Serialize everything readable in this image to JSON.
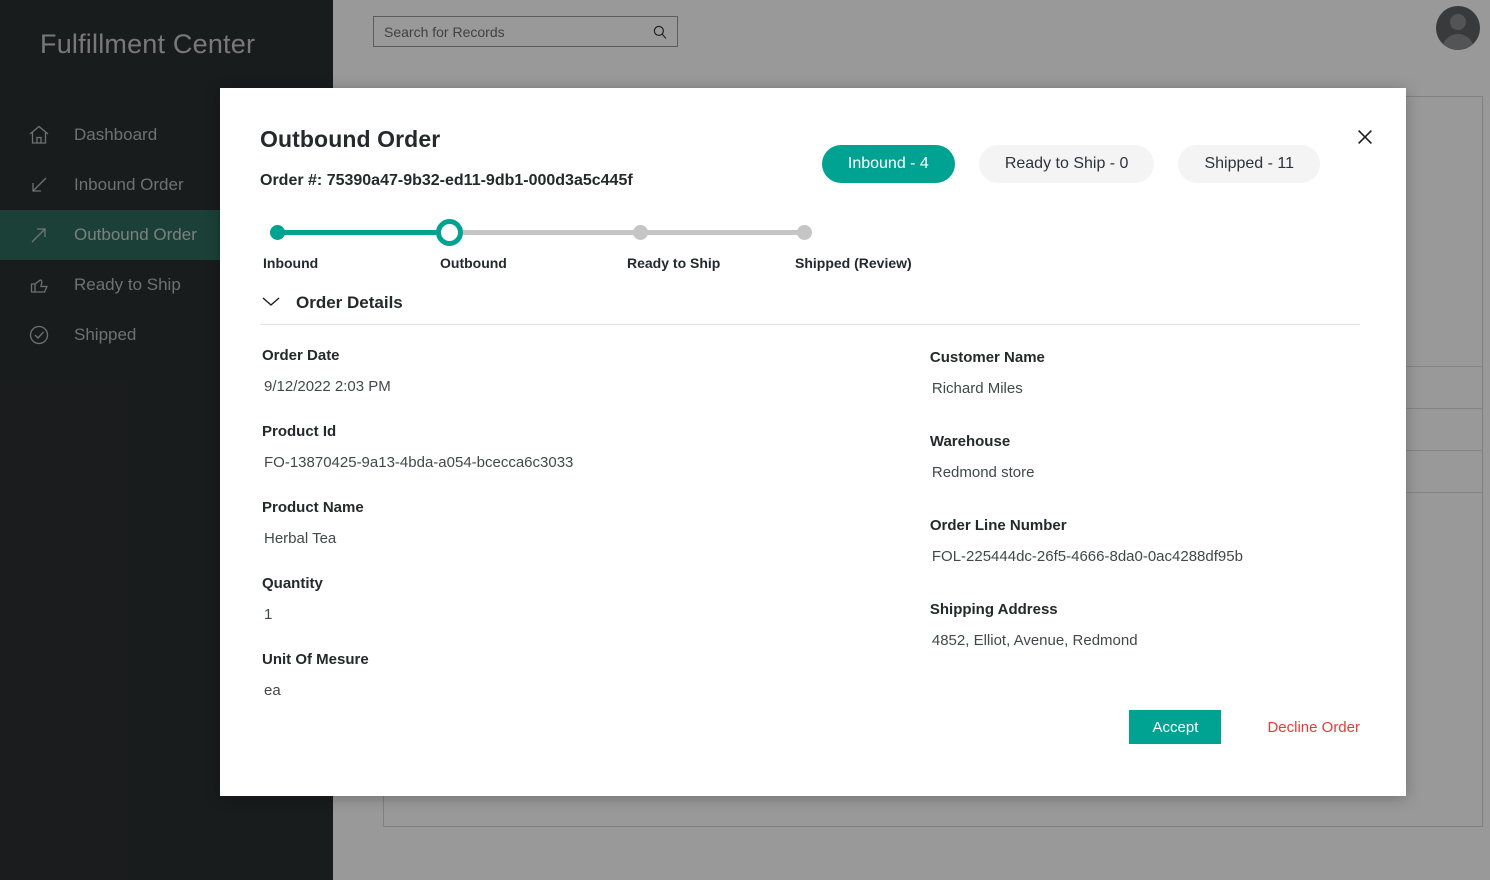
{
  "sidebar": {
    "brand": "Fulfillment Center",
    "items": [
      {
        "label": "Dashboard",
        "icon": "home-icon",
        "active": false
      },
      {
        "label": "Inbound Order",
        "icon": "arrow-down-left-icon",
        "active": false
      },
      {
        "label": "Outbound Order",
        "icon": "arrow-up-right-icon",
        "active": true
      },
      {
        "label": "Ready to Ship",
        "icon": "thumbs-up-icon",
        "active": false
      },
      {
        "label": "Shipped",
        "icon": "check-circle-icon",
        "active": false
      }
    ]
  },
  "topbar": {
    "search_placeholder": "Search for Records",
    "search_value": "",
    "search_icon": "search-icon",
    "avatar_icon": "user-avatar-icon"
  },
  "modal": {
    "title": "Outbound Order",
    "order_number_label": "Order #: 75390a47-9b32-ed11-9db1-000d3a5c445f",
    "close_icon": "close-icon",
    "tabs": [
      {
        "label": "Inbound - 4",
        "active": true
      },
      {
        "label": "Ready to Ship - 0",
        "active": false
      },
      {
        "label": "Shipped - 11",
        "active": false
      }
    ],
    "stepper": {
      "steps": [
        {
          "label": "Inbound",
          "state": "done"
        },
        {
          "label": "Outbound",
          "state": "current"
        },
        {
          "label": "Ready to Ship",
          "state": "pending"
        },
        {
          "label": "Shipped (Review)",
          "state": "pending"
        }
      ]
    },
    "section": {
      "title": "Order Details",
      "chevron_icon": "chevron-down-icon"
    },
    "fields_left": [
      {
        "label": "Order Date",
        "value": "9/12/2022 2:03 PM"
      },
      {
        "label": "Product Id",
        "value": "FO-13870425-9a13-4bda-a054-bcecca6c3033"
      },
      {
        "label": "Product Name",
        "value": "Herbal Tea"
      },
      {
        "label": "Quantity",
        "value": "1"
      },
      {
        "label": "Unit Of Mesure",
        "value": "ea"
      }
    ],
    "fields_right": [
      {
        "label": "Customer Name",
        "value": "Richard Miles"
      },
      {
        "label": "Warehouse",
        "value": "Redmond store"
      },
      {
        "label": "Order Line Number",
        "value": "FOL-225444dc-26f5-4666-8da0-0ac4288df95b"
      },
      {
        "label": "Shipping Address",
        "value": "4852, Elliot, Avenue, Redmond"
      }
    ],
    "actions": {
      "accept_label": "Accept",
      "decline_label": "Decline Order"
    }
  },
  "colors": {
    "accent_teal": "#00a391",
    "sidebar_bg": "#2b2f31",
    "sidebar_active": "#2e6b5c",
    "decline_red": "#e83b34"
  }
}
